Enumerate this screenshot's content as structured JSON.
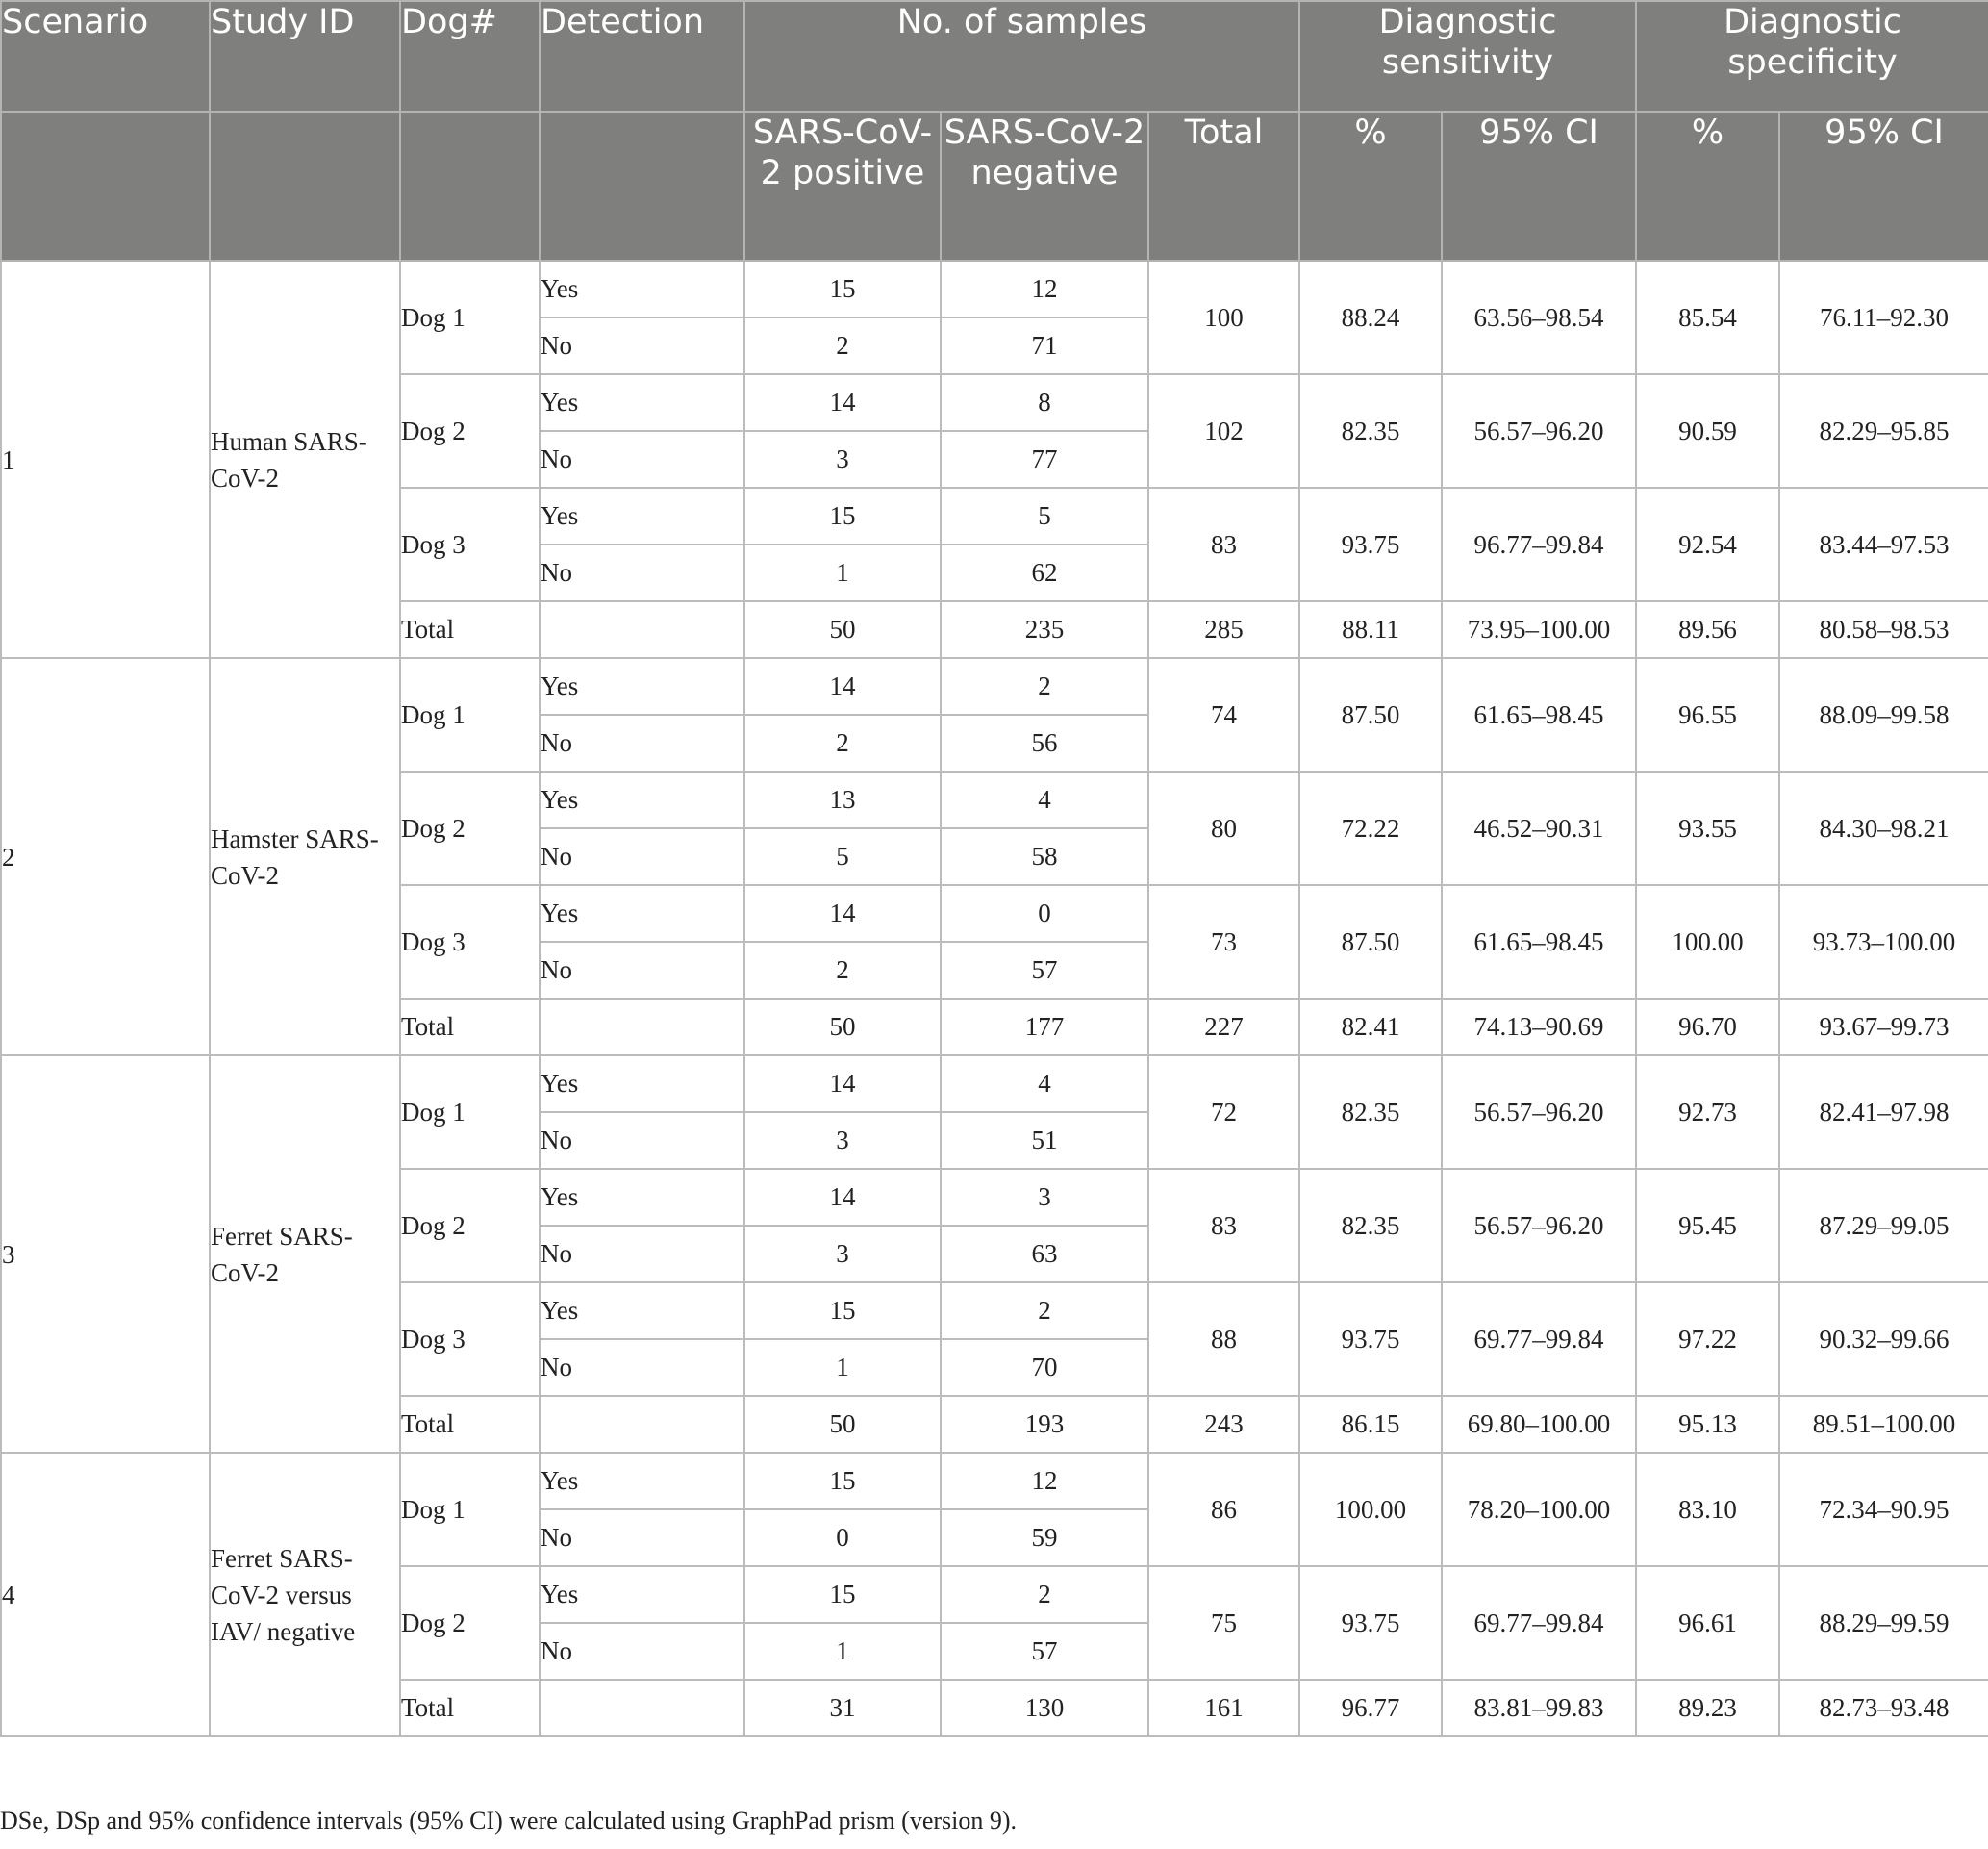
{
  "header": {
    "scenario": "Scenario",
    "study_id": "Study ID",
    "dog": "Dog#",
    "detection": "Detection",
    "no_samples": "No. of samples",
    "dse": "Diagnostic sensitivity",
    "dsp": "Diagnostic specificity",
    "pos": "SARS-CoV-2 positive",
    "neg": "SARS-CoV-2 negative",
    "total": "Total",
    "pct": "%",
    "ci": "95% CI"
  },
  "rows": [
    [
      "1",
      "Human SARS-CoV-2",
      "Dog 1",
      "Yes",
      "15",
      "12",
      "100",
      "88.24",
      "63.56–98.54",
      "85.54",
      "76.11–92.30"
    ],
    [
      "",
      "",
      "",
      "No",
      "2",
      "71",
      "",
      "",
      "",
      "",
      ""
    ],
    [
      "",
      "",
      "Dog 2",
      "Yes",
      "14",
      "8",
      "102",
      "82.35",
      "56.57–96.20",
      "90.59",
      "82.29–95.85"
    ],
    [
      "",
      "",
      "",
      "No",
      "3",
      "77",
      "",
      "",
      "",
      "",
      ""
    ],
    [
      "",
      "",
      "Dog 3",
      "Yes",
      "15",
      "5",
      "83",
      "93.75",
      "96.77–99.84",
      "92.54",
      "83.44–97.53"
    ],
    [
      "",
      "",
      "",
      "No",
      "1",
      "62",
      "",
      "",
      "",
      "",
      ""
    ],
    [
      "",
      "",
      "Total",
      "",
      "50",
      "235",
      "285",
      "88.11",
      "73.95–100.00",
      "89.56",
      "80.58–98.53"
    ],
    [
      "2",
      "Hamster SARS-CoV-2",
      "Dog 1",
      "Yes",
      "14",
      "2",
      "74",
      "87.50",
      "61.65–98.45",
      "96.55",
      "88.09–99.58"
    ],
    [
      "",
      "",
      "",
      "No",
      "2",
      "56",
      "",
      "",
      "",
      "",
      ""
    ],
    [
      "",
      "",
      "Dog 2",
      "Yes",
      "13",
      "4",
      "80",
      "72.22",
      "46.52–90.31",
      "93.55",
      "84.30–98.21"
    ],
    [
      "",
      "",
      "",
      "No",
      "5",
      "58",
      "",
      "",
      "",
      "",
      ""
    ],
    [
      "",
      "",
      "Dog 3",
      "Yes",
      "14",
      "0",
      "73",
      "87.50",
      "61.65–98.45",
      "100.00",
      "93.73–100.00"
    ],
    [
      "",
      "",
      "",
      "No",
      "2",
      "57",
      "",
      "",
      "",
      "",
      ""
    ],
    [
      "",
      "",
      "Total",
      "",
      "50",
      "177",
      "227",
      "82.41",
      "74.13–90.69",
      "96.70",
      "93.67–99.73"
    ],
    [
      "3",
      "Ferret SARS-CoV-2",
      "Dog 1",
      "Yes",
      "14",
      "4",
      "72",
      "82.35",
      "56.57–96.20",
      "92.73",
      "82.41–97.98"
    ],
    [
      "",
      "",
      "",
      "No",
      "3",
      "51",
      "",
      "",
      "",
      "",
      ""
    ],
    [
      "",
      "",
      "Dog 2",
      "Yes",
      "14",
      "3",
      "83",
      "82.35",
      "56.57–96.20",
      "95.45",
      "87.29–99.05"
    ],
    [
      "",
      "",
      "",
      "No",
      "3",
      "63",
      "",
      "",
      "",
      "",
      ""
    ],
    [
      "",
      "",
      "Dog 3",
      "Yes",
      "15",
      "2",
      "88",
      "93.75",
      "69.77–99.84",
      "97.22",
      "90.32–99.66"
    ],
    [
      "",
      "",
      "",
      "No",
      "1",
      "70",
      "",
      "",
      "",
      "",
      ""
    ],
    [
      "",
      "",
      "Total",
      "",
      "50",
      "193",
      "243",
      "86.15",
      "69.80–100.00",
      "95.13",
      "89.51–100.00"
    ],
    [
      "4",
      "Ferret SARS-CoV-2 versus IAV/ negative",
      "Dog 1",
      "Yes",
      "15",
      "12",
      "86",
      "100.00",
      "78.20–100.00",
      "83.10",
      "72.34–90.95"
    ],
    [
      "",
      "",
      "",
      "No",
      "0",
      "59",
      "",
      "",
      "",
      "",
      ""
    ],
    [
      "",
      "",
      "Dog 2",
      "Yes",
      "15",
      "2",
      "75",
      "93.75",
      "69.77–99.84",
      "96.61",
      "88.29–99.59"
    ],
    [
      "",
      "",
      "",
      "No",
      "1",
      "57",
      "",
      "",
      "",
      "",
      ""
    ],
    [
      "",
      "",
      "Total",
      "",
      "31",
      "130",
      "161",
      "96.77",
      "83.81–99.83",
      "89.23",
      "82.73–93.48"
    ]
  ],
  "footnote": "DSe, DSp and 95% confidence intervals (95% CI) were calculated using GraphPad prism (version 9)."
}
